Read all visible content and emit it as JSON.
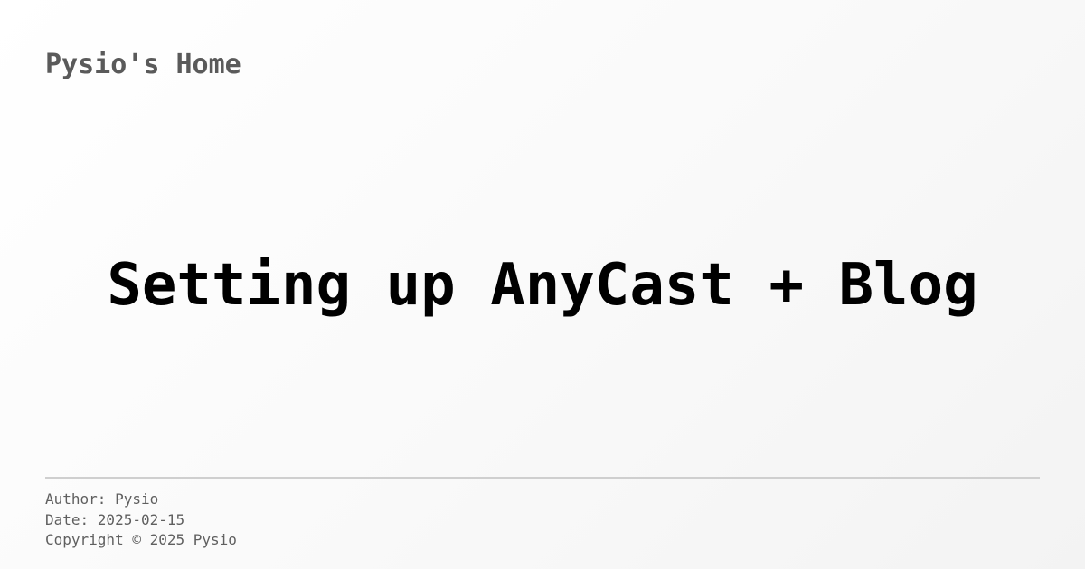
{
  "site": {
    "name": "Pysio's Home"
  },
  "post": {
    "title": "Setting up AnyCast + Blog"
  },
  "footer": {
    "author": "Author: Pysio",
    "date": "Date: 2025-02-15",
    "copyright": "Copyright © 2025 Pysio"
  },
  "colors": {
    "title": "#000000",
    "site_name": "#5a5a5a",
    "meta_text": "#5f5f5f",
    "divider": "#cfcfcf",
    "background": "#f9f9f9"
  }
}
